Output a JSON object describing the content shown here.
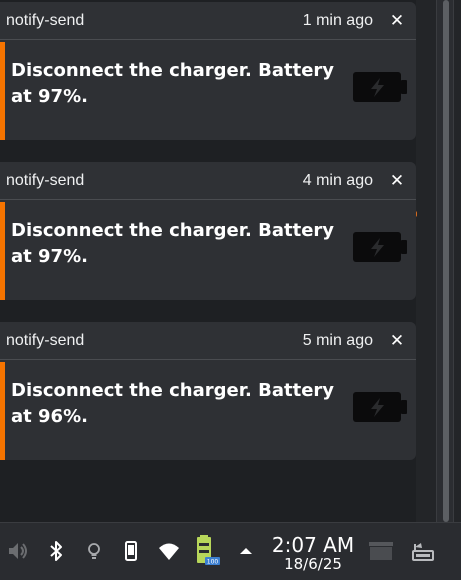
{
  "notifications": [
    {
      "app": "notify-send",
      "time": "1 min ago",
      "message": "Disconnect the charger. Battery at 97%.",
      "close": "✕",
      "icon": "battery-charging-icon"
    },
    {
      "app": "notify-send",
      "time": "4 min ago",
      "message": "Disconnect the charger. Battery at 97%.",
      "close": "✕",
      "icon": "battery-charging-icon"
    },
    {
      "app": "notify-send",
      "time": "5 min ago",
      "message": "Disconnect the charger. Battery at 96%.",
      "close": "✕",
      "icon": "battery-charging-icon"
    }
  ],
  "taskbar": {
    "tray_icons": [
      "volume-muted-icon",
      "bluetooth-icon",
      "lightbulb-icon",
      "phone-icon",
      "wifi-icon",
      "battery-icon",
      "arrow-up-icon"
    ],
    "battery_label": "100",
    "clock_time": "2:07 AM",
    "clock_date": "18/6/25",
    "right_icons": [
      "desktop-icon",
      "window-list-icon"
    ]
  },
  "colors": {
    "accent": "#f67400",
    "card_bg": "#2e3034",
    "text": "#ffffff",
    "taskbar_bg": "#2a2c30"
  }
}
